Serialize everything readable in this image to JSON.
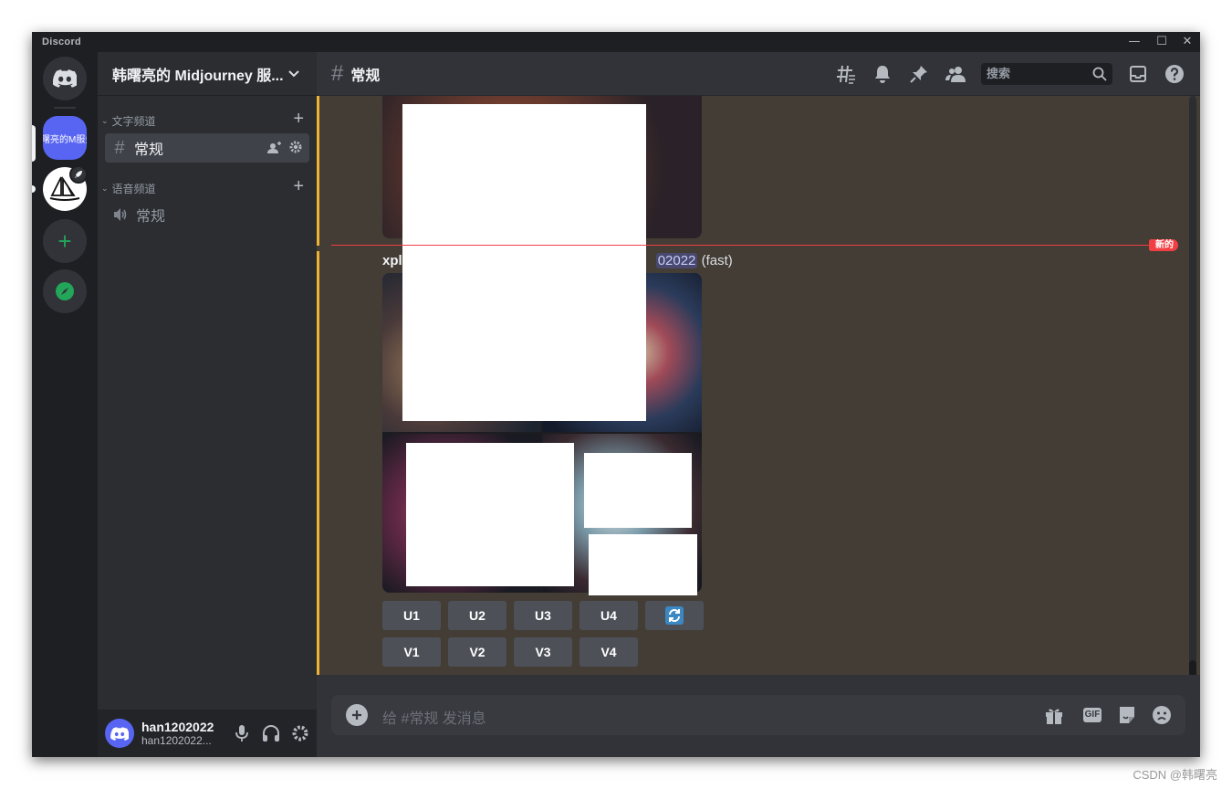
{
  "window": {
    "app_title": "Discord",
    "minimize": "—",
    "maximize": "☐",
    "close": "✕"
  },
  "servers": [
    {
      "name": "home",
      "icon": "discord-logo-icon"
    },
    {
      "name": "active_server",
      "label": "曙亮的M服务"
    },
    {
      "name": "midjourney",
      "icon": "midjourney-sailboat-icon"
    },
    {
      "name": "add_server",
      "label": "+"
    },
    {
      "name": "explore",
      "icon": "compass-icon"
    }
  ],
  "guild": {
    "name": "韩曙亮的 Midjourney 服..."
  },
  "categories": {
    "text": {
      "label": "文字频道",
      "add": "+"
    },
    "voice": {
      "label": "语音频道",
      "add": "+"
    }
  },
  "channels": {
    "text_general": {
      "hash": "#",
      "label": "常规"
    },
    "voice_general": {
      "label": "常规"
    }
  },
  "user": {
    "display_name": "han1202022",
    "username": "han1202022..."
  },
  "header": {
    "hash": "#",
    "channel": "常规",
    "search_placeholder": "搜索"
  },
  "divider": {
    "new_label": "新的"
  },
  "message": {
    "author": "xpl",
    "mention": "02022",
    "suffix": " (fast)"
  },
  "buttons": {
    "upscale": [
      "U1",
      "U2",
      "U3",
      "U4"
    ],
    "variation": [
      "V1",
      "V2",
      "V3",
      "V4"
    ],
    "reroll_icon": "refresh-icon"
  },
  "composer": {
    "placeholder": "给 #常规 发消息",
    "gif": "GIF"
  },
  "watermark": "CSDN @韩曙亮",
  "colors": {
    "accent": "#5865f2",
    "mention_bar": "#f0b232",
    "new_divider": "#f23f43",
    "online": "#23a55a"
  }
}
